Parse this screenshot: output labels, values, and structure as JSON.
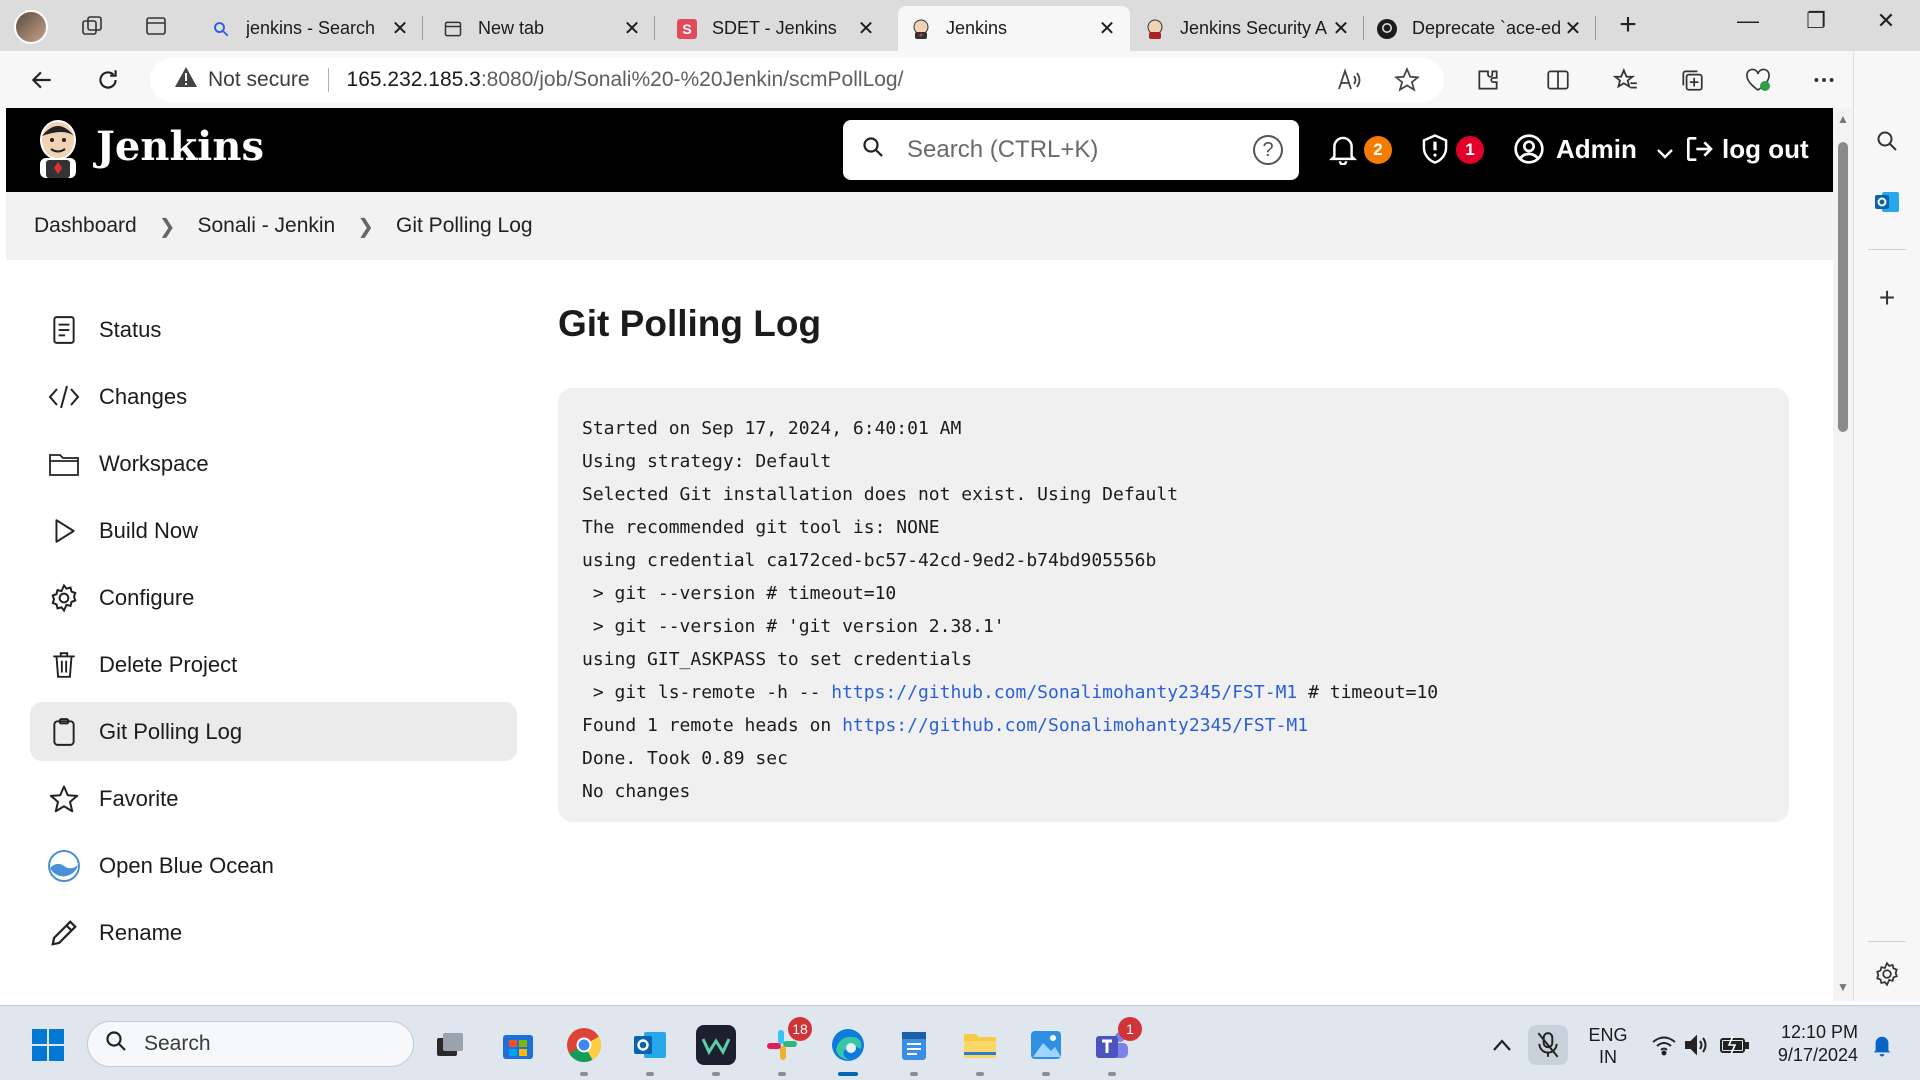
{
  "browser": {
    "tabs": [
      {
        "title": "jenkins - Search",
        "icon": "search-icon"
      },
      {
        "title": "New tab",
        "icon": "new-tab-icon"
      },
      {
        "title": "SDET - Jenkins",
        "icon": "sdet-favicon"
      },
      {
        "title": "Jenkins",
        "icon": "jenkins-favicon"
      },
      {
        "title": "Jenkins Security A",
        "icon": "jenkins-favicon"
      },
      {
        "title": "Deprecate `ace-ed",
        "icon": "github-icon"
      }
    ],
    "active_tab": 3,
    "address": {
      "security": "Not secure",
      "host": "165.232.185.3",
      "path": ":8080/job/Sonali%20-%20Jenkin/scmPollLog/"
    }
  },
  "jenkins": {
    "title": "Jenkins",
    "search_placeholder": "Search (CTRL+K)",
    "notifications_count": "2",
    "security_count": "1",
    "user": "Admin",
    "logout": "log out",
    "colors": {
      "header": "#000000",
      "notif_badge": "#f57c00",
      "security_badge": "#e0002a",
      "link": "#2b5fd9"
    }
  },
  "breadcrumb": [
    "Dashboard",
    "Sonali - Jenkin",
    "Git Polling Log"
  ],
  "sidebar": {
    "items": [
      {
        "label": "Status",
        "icon": "notepad-icon"
      },
      {
        "label": "Changes",
        "icon": "code-icon"
      },
      {
        "label": "Workspace",
        "icon": "folder-icon"
      },
      {
        "label": "Build Now",
        "icon": "play-icon"
      },
      {
        "label": "Configure",
        "icon": "gear-icon"
      },
      {
        "label": "Delete Project",
        "icon": "trash-icon"
      },
      {
        "label": "Git Polling Log",
        "icon": "clipboard-icon"
      },
      {
        "label": "Favorite",
        "icon": "star-icon"
      },
      {
        "label": "Open Blue Ocean",
        "icon": "blue-ocean-icon"
      },
      {
        "label": "Rename",
        "icon": "pencil-icon"
      }
    ],
    "active_index": 6
  },
  "main": {
    "title": "Git Polling Log",
    "log": {
      "l0": "Started on Sep 17, 2024, 6:40:01 AM",
      "l1": "Using strategy: Default",
      "l2": "Selected Git installation does not exist. Using Default",
      "l3": "The recommended git tool is: NONE",
      "l4": "using credential ca172ced-bc57-42cd-9ed2-b74bd905556b",
      "l5": " > git --version # timeout=10",
      "l6": " > git --version # 'git version 2.38.1'",
      "l7": "using GIT_ASKPASS to set credentials",
      "l8_pre": " > git ls-remote -h -- ",
      "l8_link": "https://github.com/Sonalimohanty2345/FST-M1",
      "l8_post": " # timeout=10",
      "l9_pre": "Found 1 remote heads on ",
      "l9_link": "https://github.com/Sonalimohanty2345/FST-M1",
      "l10": "Done. Took 0.89 sec",
      "l11": "No changes"
    }
  },
  "taskbar": {
    "search": "Search",
    "slack_badge": "18",
    "teams_badge": "1",
    "lang_top": "ENG",
    "lang_bottom": "IN",
    "time": "12:10 PM",
    "date": "9/17/2024"
  }
}
